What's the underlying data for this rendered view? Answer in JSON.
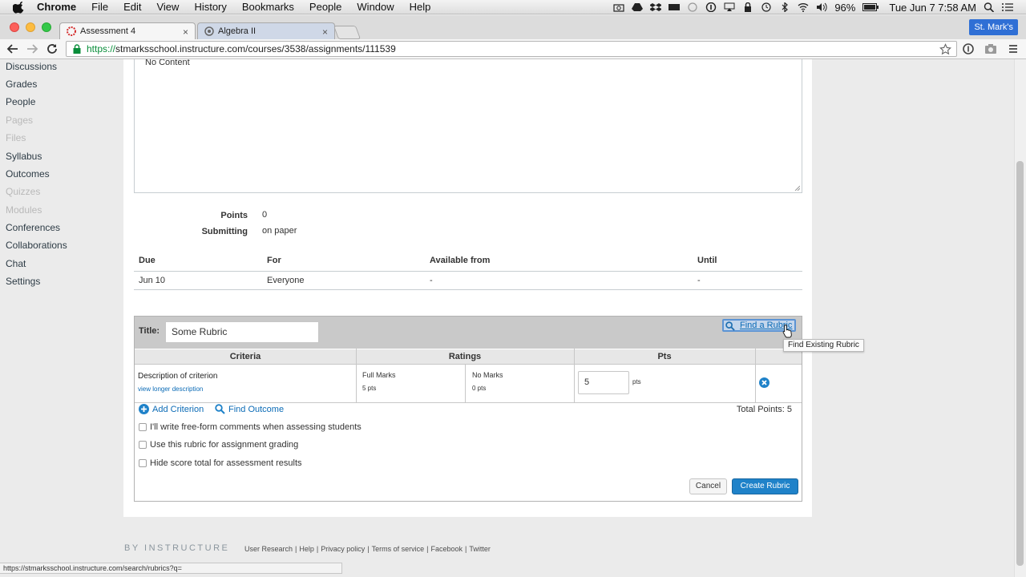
{
  "menubar": {
    "app": "Chrome",
    "items": [
      "File",
      "Edit",
      "View",
      "History",
      "Bookmarks",
      "People",
      "Window",
      "Help"
    ],
    "battery": "96%",
    "clock": "Tue Jun 7  7:58 AM"
  },
  "tabs": [
    {
      "label": "Assessment 4",
      "close": "×"
    },
    {
      "label": "Algebra II",
      "close": "×"
    }
  ],
  "profile_label": "St. Mark's",
  "url": {
    "scheme": "https://",
    "rest": "stmarksschool.instructure.com/courses/3538/assignments/111539"
  },
  "sidebar": {
    "items": [
      {
        "label": "Discussions"
      },
      {
        "label": "Grades"
      },
      {
        "label": "People"
      },
      {
        "label": "Pages"
      },
      {
        "label": "Files"
      },
      {
        "label": "Syllabus"
      },
      {
        "label": "Outcomes"
      },
      {
        "label": "Quizzes"
      },
      {
        "label": "Modules"
      },
      {
        "label": "Conferences"
      },
      {
        "label": "Collaborations"
      },
      {
        "label": "Chat"
      },
      {
        "label": "Settings"
      }
    ]
  },
  "editor": {
    "placeholder": "No Content"
  },
  "details": {
    "points_label": "Points",
    "points_value": "0",
    "submitting_label": "Submitting",
    "submitting_value": "on paper"
  },
  "due_table": {
    "headers": [
      "Due",
      "For",
      "Available from",
      "Until"
    ],
    "row": [
      "Jun 10",
      "Everyone",
      "-",
      "-"
    ]
  },
  "rubric": {
    "title_label": "Title:",
    "title_value": "Some Rubric",
    "find_rubric": "Find a Rubric",
    "tooltip": "Find Existing Rubric",
    "headers": {
      "criteria": "Criteria",
      "ratings": "Ratings",
      "pts": "Pts"
    },
    "criterion": {
      "description": "Description of criterion",
      "longer": "view longer description",
      "ratings": [
        {
          "title": "Full Marks",
          "pts": "5 pts"
        },
        {
          "title": "No Marks",
          "pts": "0 pts"
        }
      ],
      "points": "5",
      "pts_unit": "pts"
    },
    "add_criterion": "Add Criterion",
    "find_outcome": "Find Outcome",
    "total_points": "Total Points: 5",
    "options": [
      "I'll write free-form comments when assessing students",
      "Use this rubric for assignment grading",
      "Hide score total for assessment results"
    ],
    "cancel": "Cancel",
    "create": "Create Rubric"
  },
  "footer": {
    "brand": "BY INSTRUCTURE",
    "links": [
      "User Research",
      "Help",
      "Privacy policy",
      "Terms of service",
      "Facebook",
      "Twitter"
    ]
  },
  "status_url": "https://stmarksschool.instructure.com/search/rubrics?q=",
  "colors": {
    "link": "#0b6bb6",
    "primary_button": "#1f82c9",
    "https_green": "#098d3a"
  }
}
